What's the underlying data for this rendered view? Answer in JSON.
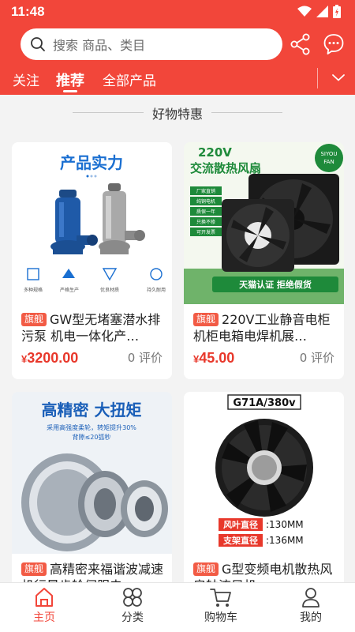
{
  "status_bar": {
    "time": "11:48"
  },
  "search": {
    "placeholder": "搜索 商品、类目"
  },
  "tabs": [
    {
      "label": "关注"
    },
    {
      "label": "推荐",
      "active": true
    },
    {
      "label": "全部产品"
    }
  ],
  "section": {
    "title": "好物特惠"
  },
  "products": [
    {
      "badge": "旗舰",
      "title": "GW型无堵塞潜水排污泵 机电一体化产…",
      "price": "3200.00",
      "currency": "¥",
      "reviews": "0 评价",
      "image_text": {
        "headline": "产品实力",
        "features": [
          "多种规格",
          "严格生产",
          "优良材质",
          "持久耐用"
        ]
      }
    },
    {
      "badge": "旗舰",
      "title": "220V工业静音电柜机柜电箱电焊机展…",
      "price": "45.00",
      "currency": "¥",
      "reviews": "0 评价",
      "image_text": {
        "headline_1": "220V",
        "headline_2": "交流散热风扇",
        "brand_1": "SIYOU",
        "brand_2": "FAN",
        "bullets": [
          "厂家直销",
          "纯铜电机",
          "质保一年",
          "只换不修",
          "可开发票"
        ],
        "banner": "天猫认证  拒绝假货"
      }
    },
    {
      "badge": "旗舰",
      "title": "高精密来福谐波减速机行星齿轮伺服电",
      "price": "",
      "currency": "¥",
      "reviews": "",
      "image_text": {
        "headline": "高精密  大扭矩",
        "sub_1": "采用高强度柔轮，转矩提升30%",
        "sub_2": "背隙≤20弧秒"
      }
    },
    {
      "badge": "旗舰",
      "title": "G型变频电机散热风扇轴流风机",
      "price": "",
      "currency": "¥",
      "reviews": "",
      "image_text": {
        "model": "G71A/380v",
        "spec_1_label": "风叶直径",
        "spec_1_value": ":130MM",
        "spec_2_label": "支架直径",
        "spec_2_value": ":136MM"
      }
    }
  ],
  "bottom_nav": [
    {
      "label": "主页",
      "icon": "home-icon",
      "active": true
    },
    {
      "label": "分类",
      "icon": "category-icon"
    },
    {
      "label": "购物车",
      "icon": "cart-icon"
    },
    {
      "label": "我的",
      "icon": "profile-icon"
    }
  ],
  "colors": {
    "brand": "#f2463a",
    "price": "#e8382b",
    "badge": "#f25b45",
    "background": "#f3f3f3"
  }
}
